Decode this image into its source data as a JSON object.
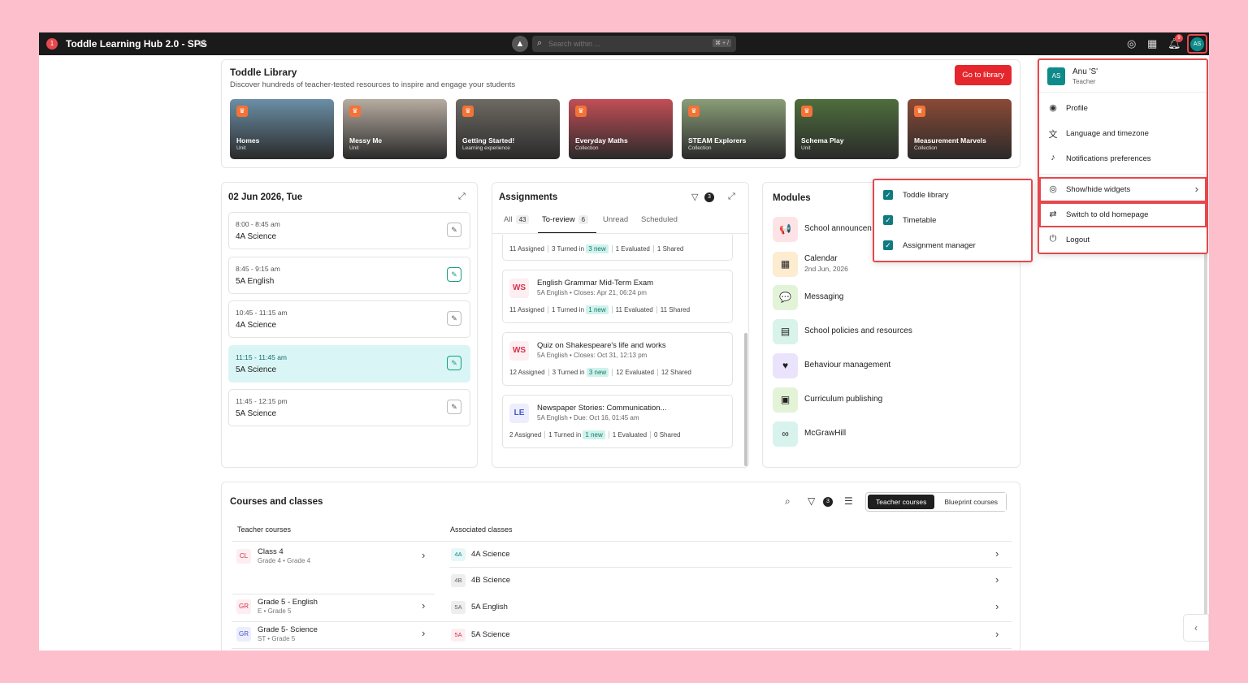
{
  "topbar": {
    "app_title": "Toddle Learning Hub 2.0 - SPS",
    "notif_badge": "1",
    "search_placeholder": "Search within ...",
    "search_shortcut": "⌘ + /",
    "bell_count": "9",
    "avatar_initials": "AS"
  },
  "library": {
    "title": "Toddle Library",
    "subtitle": "Discover hundreds of teacher-tested resources to inspire and engage your students",
    "button": "Go to library",
    "tiles": [
      {
        "name": "Homes",
        "type": "Unit",
        "color": "#6b8fa6"
      },
      {
        "name": "Messy Me",
        "type": "Unit",
        "color": "#b7aca1"
      },
      {
        "name": "Getting Started!",
        "type": "Learning experience",
        "color": "#6e6a63"
      },
      {
        "name": "Everyday Maths",
        "type": "Collection",
        "color": "#c24e57"
      },
      {
        "name": "STEAM Explorers",
        "type": "Collection",
        "color": "#8a9d78"
      },
      {
        "name": "Schema Play",
        "type": "Unit",
        "color": "#4e6e3d"
      },
      {
        "name": "Measurement Marvels",
        "type": "Collection",
        "color": "#8b4a36"
      }
    ]
  },
  "calendar": {
    "date": "02 Jun 2026, Tue",
    "slots": [
      {
        "time": "8:00 - 8:45 am",
        "class": "4A Science"
      },
      {
        "time": "8:45 - 9:15 am",
        "class": "5A English"
      },
      {
        "time": "10:45 - 11:15 am",
        "class": "4A Science"
      },
      {
        "time": "11:15 - 11:45 am",
        "class": "5A Science"
      },
      {
        "time": "11:45 - 12:15 pm",
        "class": "5A Science"
      }
    ]
  },
  "assignments": {
    "title": "Assignments",
    "filter_count": "3",
    "tabs": [
      {
        "label": "All",
        "count": "43"
      },
      {
        "label": "To-review",
        "count": "6"
      },
      {
        "label": "Unread",
        "count": ""
      },
      {
        "label": "Scheduled",
        "count": ""
      }
    ],
    "partial_stats": {
      "assigned": "11 Assigned",
      "turned": "3 Turned in",
      "new": "3 new",
      "evaluated": "1 Evaluated",
      "shared": "1 Shared"
    },
    "items": [
      {
        "badge": "WS",
        "title": "English Grammar Mid-Term Exam",
        "meta": "5A English • Closes: Apr 21, 06:24 pm",
        "assigned": "11 Assigned",
        "turned": "1 Turned in",
        "new": "1 new",
        "evaluated": "11 Evaluated",
        "shared": "11 Shared"
      },
      {
        "badge": "WS",
        "title": "Quiz on Shakespeare's life and works",
        "meta": "5A English • Closes: Oct 31, 12:13 pm",
        "assigned": "12 Assigned",
        "turned": "3 Turned in",
        "new": "3 new",
        "evaluated": "12 Evaluated",
        "shared": "12 Shared"
      },
      {
        "badge": "LE",
        "title": "Newspaper Stories: Communication...",
        "meta": "5A English • Due: Oct 16, 01:45 am",
        "assigned": "2 Assigned",
        "turned": "1 Turned in",
        "new": "1 new",
        "evaluated": "1 Evaluated",
        "shared": "0 Shared"
      }
    ]
  },
  "modules": {
    "title": "Modules",
    "items": [
      {
        "name": "School announcen",
        "sub": "",
        "icon": "megaphone-icon",
        "bg": "#fde3e6",
        "glyph": "📢"
      },
      {
        "name": "Calendar",
        "sub": "2nd Jun, 2026",
        "icon": "calendar-icon",
        "bg": "#fdeccf",
        "glyph": "▦"
      },
      {
        "name": "Messaging",
        "sub": "",
        "icon": "chat-icon",
        "bg": "#e3f3d8",
        "glyph": "💬"
      },
      {
        "name": "School policies and resources",
        "sub": "",
        "icon": "document-icon",
        "bg": "#d8f3ea",
        "glyph": "▤"
      },
      {
        "name": "Behaviour management",
        "sub": "",
        "icon": "heart-icon",
        "bg": "#ebe3fb",
        "glyph": "♥"
      },
      {
        "name": "Curriculum publishing",
        "sub": "",
        "icon": "book-icon",
        "bg": "#e3f3d8",
        "glyph": "▣"
      },
      {
        "name": "McGrawHill",
        "sub": "",
        "icon": "link-icon",
        "bg": "#d8f3ee",
        "glyph": "∞"
      }
    ]
  },
  "courses": {
    "title": "Courses and classes",
    "filter_count": "3",
    "seg_teacher": "Teacher courses",
    "seg_blueprint": "Blueprint courses",
    "col_teacher": "Teacher courses",
    "col_classes": "Associated classes",
    "rows": [
      {
        "badge": "CL",
        "name": "Class 4",
        "sub": "Grade 4 • Grade 4"
      },
      {
        "badge": "GR",
        "name": "Grade 5 - English",
        "sub": "E • Grade 5"
      },
      {
        "badge": "GR",
        "name": "Grade 5- Science",
        "sub": "ST • Grade 5"
      }
    ],
    "classes": [
      {
        "code": "4A",
        "name": "4A Science"
      },
      {
        "code": "4B",
        "name": "4B Science"
      },
      {
        "code": "5A",
        "name": "5A English"
      },
      {
        "code": "5A",
        "name": "5A Science"
      }
    ]
  },
  "profile_menu": {
    "initials": "AS",
    "name": "Anu 'S'",
    "role": "Teacher",
    "items": {
      "profile": "Profile",
      "language": "Language and timezone",
      "notifications": "Notifications preferences",
      "widgets": "Show/hide widgets",
      "old_home": "Switch to old homepage",
      "logout": "Logout"
    }
  },
  "widgets_panel": {
    "items": [
      "Toddle library",
      "Timetable",
      "Assignment manager"
    ]
  }
}
